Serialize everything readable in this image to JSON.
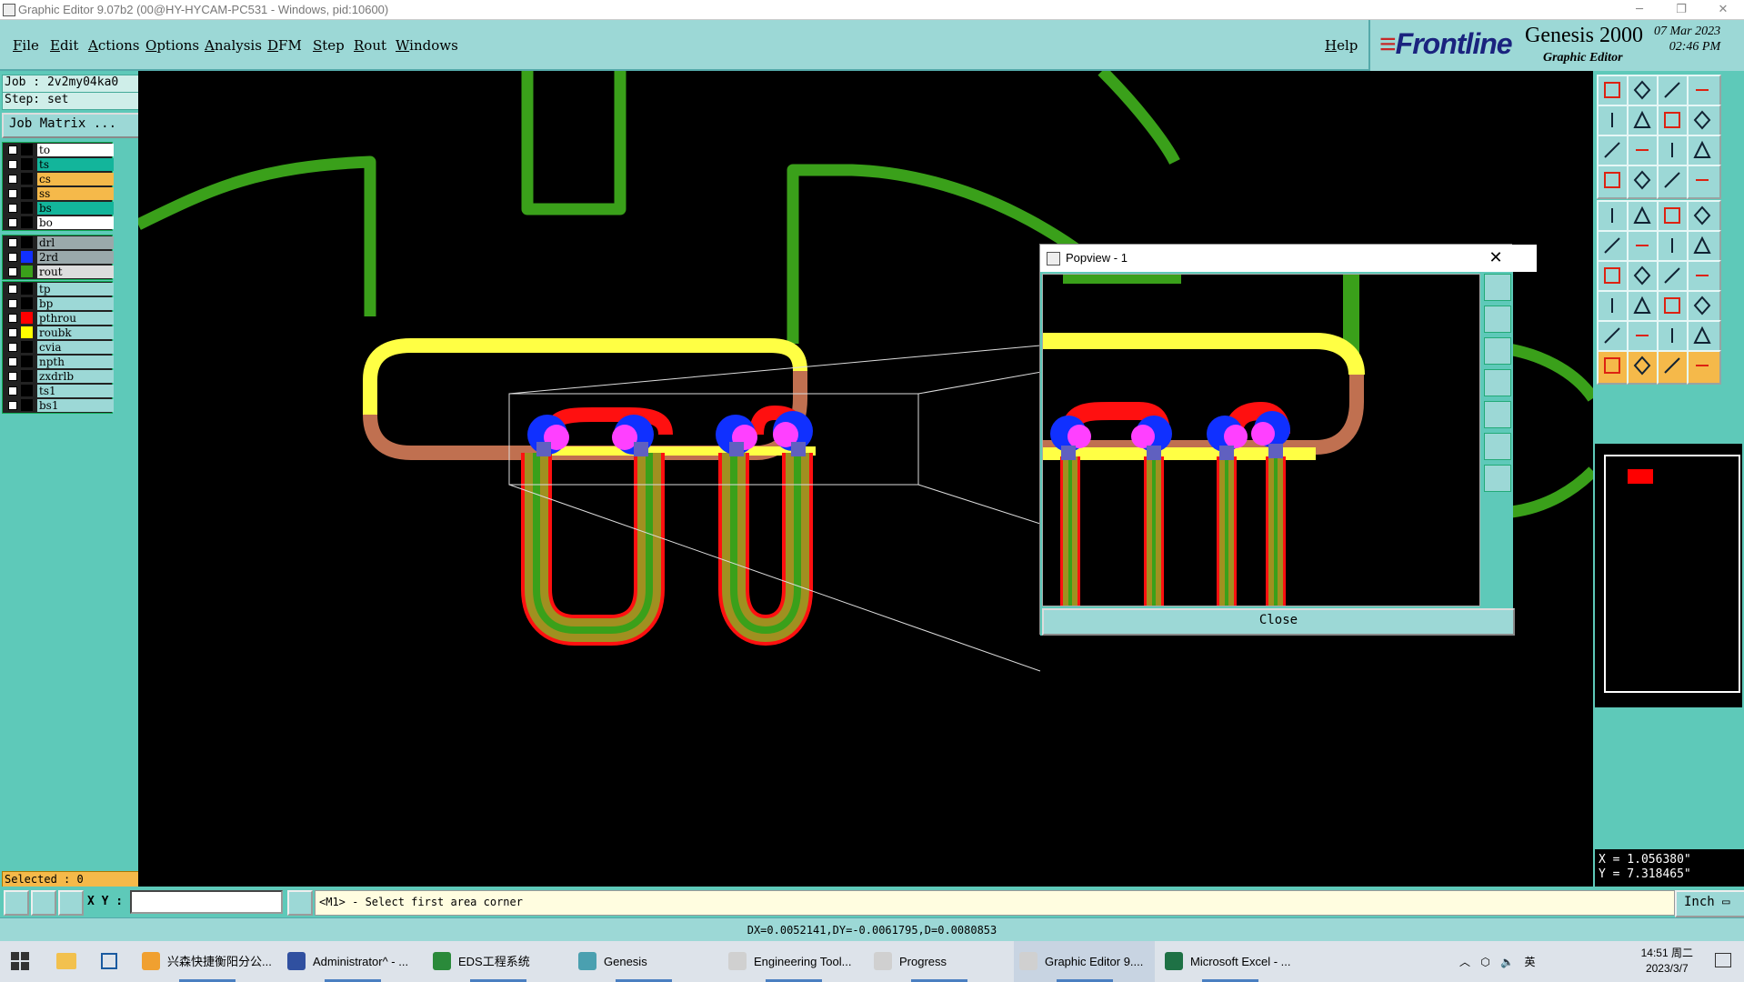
{
  "window": {
    "title": "Graphic Editor 9.07b2 (00@HY-HYCAM-PC531 - Windows, pid:10600)",
    "minimize": "─",
    "restore": "❐",
    "close": "✕"
  },
  "menu": {
    "items": [
      "File",
      "Edit",
      "Actions",
      "Options",
      "Analysis",
      "DFM",
      "Step",
      "Rout",
      "Windows"
    ],
    "help": "Help"
  },
  "logo": {
    "brand": "Frontline",
    "product": "Genesis 2000",
    "subtitle": "Graphic Editor",
    "date": "07 Mar 2023",
    "time": "02:46 PM"
  },
  "job": {
    "job_line": "Job : 2v2my04ka0",
    "step_line": "Step: set",
    "matrix_button": "Job Matrix ..."
  },
  "layers": {
    "group1": [
      {
        "name": "to",
        "bg": "#ffffff",
        "swatch": "#000000"
      },
      {
        "name": "ts",
        "bg": "#13b59b",
        "swatch": "#000000"
      },
      {
        "name": "cs",
        "bg": "#f5b94a",
        "swatch": "#000000"
      },
      {
        "name": "ss",
        "bg": "#f5b94a",
        "swatch": "#000000"
      },
      {
        "name": "bs",
        "bg": "#13b59b",
        "swatch": "#000000"
      },
      {
        "name": "bo",
        "bg": "#ffffff",
        "swatch": "#000000"
      }
    ],
    "group2": [
      {
        "name": "drl",
        "bg": "#9aa9ab",
        "swatch": "#000000"
      },
      {
        "name": "2rd",
        "bg": "#9aa9ab",
        "swatch": "#1030ff"
      },
      {
        "name": "rout",
        "bg": "#dddddd",
        "swatch": "#3aa01a"
      }
    ],
    "group3": [
      {
        "name": "tp",
        "bg": "#9cd8d6",
        "swatch": "#000000"
      },
      {
        "name": "bp",
        "bg": "#9cd8d6",
        "swatch": "#000000"
      },
      {
        "name": "pthrou",
        "bg": "#9cd8d6",
        "swatch": "#ff0000"
      },
      {
        "name": "roubk",
        "bg": "#9cd8d6",
        "swatch": "#ffff00"
      },
      {
        "name": "cvia",
        "bg": "#9cd8d6",
        "swatch": "#000000"
      },
      {
        "name": "npth",
        "bg": "#9cd8d6",
        "swatch": "#000000"
      },
      {
        "name": "zxdrlb",
        "bg": "#9cd8d6",
        "swatch": "#000000"
      },
      {
        "name": "ts1",
        "bg": "#9cd8d6",
        "swatch": "#000000"
      },
      {
        "name": "bs1",
        "bg": "#9cd8d6",
        "swatch": "#000000"
      }
    ]
  },
  "selected": "Selected : 0",
  "popview": {
    "title": "Popview - 1",
    "close_label": "Close"
  },
  "coords": {
    "x": "X = 1.056380\"",
    "y": "Y = 7.318465\""
  },
  "cmdbar": {
    "xy_label": "X Y :",
    "xy_value": "",
    "prompt": "<M1> - Select first area corner",
    "units": "Inch"
  },
  "status": "DX=0.0052141,DY=-0.0061795,D=0.0080853",
  "taskbar": {
    "items": [
      {
        "label": "兴森快捷衡阳分公...",
        "color": "#f0a030"
      },
      {
        "label": "Administrator^ - ...",
        "color": "#3050a0"
      },
      {
        "label": "EDS工程系统",
        "color": "#2a8a3a"
      },
      {
        "label": "Genesis",
        "color": "#4aa0b0"
      },
      {
        "label": "Engineering Tool...",
        "color": "#d0d0d0"
      },
      {
        "label": "Progress",
        "color": "#d0d0d0"
      },
      {
        "label": "Graphic Editor 9....",
        "color": "#d0d0d0"
      },
      {
        "label": "Microsoft Excel - ...",
        "color": "#1e7145"
      }
    ],
    "time": "14:51 周二",
    "date": "2023/3/7",
    "tray": "英"
  },
  "colors": {
    "teal": "#5ec9b9",
    "light_teal": "#9cd8d6",
    "rout_green": "#3aa01a",
    "yellow": "#ffff44",
    "brown": "#c07050",
    "red": "#ff1010",
    "blue": "#1030ff",
    "magenta": "#ff40ff"
  }
}
